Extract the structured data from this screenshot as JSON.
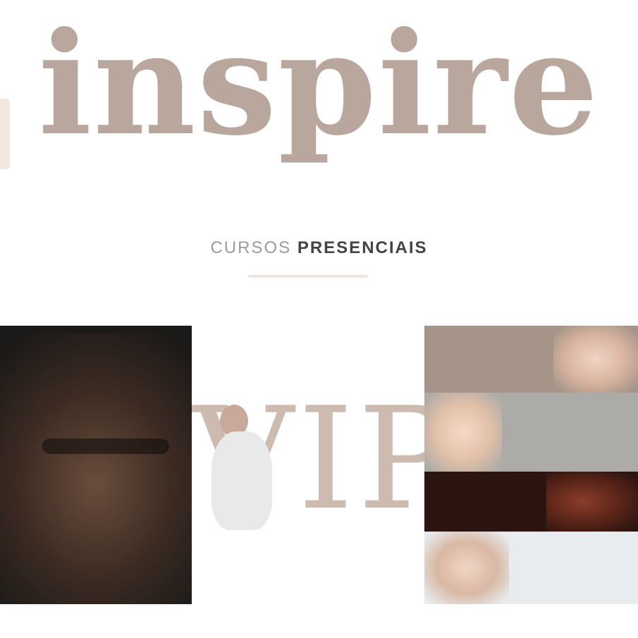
{
  "hero": {
    "title": "inspire"
  },
  "section": {
    "heading_light": "CURSOS",
    "heading_bold": "PRESENCIAIS"
  },
  "cards": [
    {
      "top_label": "",
      "mid_title": "",
      "bottom_label": "",
      "caption": ""
    },
    {
      "title": "VIP",
      "caption": ""
    },
    {
      "strips": [
        {
          "label": ""
        },
        {
          "label": ""
        },
        {
          "label": ""
        },
        {
          "label": ""
        }
      ],
      "caption": ""
    }
  ],
  "colors": {
    "brand": "#b9a79d",
    "vip": "#cdbbb0",
    "dark_card": "#1c1a18",
    "text": "#3a3a3a"
  }
}
